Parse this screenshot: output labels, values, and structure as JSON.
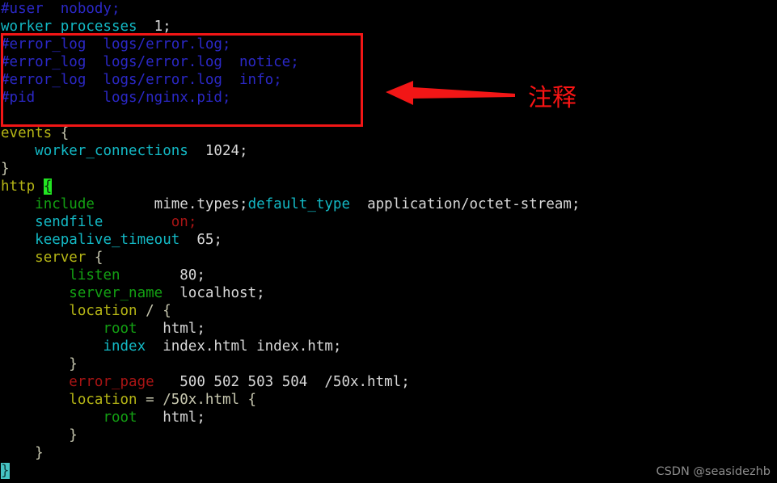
{
  "window": {
    "app": "vim",
    "file": "nginx.conf",
    "background": "#000000"
  },
  "colors": {
    "comment": "#2b28c6",
    "directive": "#13b8c4",
    "value": "#d8d8d8",
    "block": "#b5b515",
    "green": "#13a013",
    "red": "#a81414",
    "cursor_green": "#22e522",
    "cursor_cyan": "#46c3c3",
    "annotation": "#f21616"
  },
  "code": {
    "lines": [
      {
        "id": 1,
        "spans": [
          {
            "t": "#user  nobody;",
            "c": "comment"
          }
        ]
      },
      {
        "id": 2,
        "spans": [
          {
            "t": "worker_processes",
            "c": "directive"
          },
          {
            "t": "  1;",
            "c": "value"
          }
        ]
      },
      {
        "id": 3,
        "spans": [
          {
            "t": "#error_log  logs/error.log;",
            "c": "comment"
          }
        ]
      },
      {
        "id": 4,
        "spans": [
          {
            "t": "#error_log  logs/error.log  notice;",
            "c": "comment"
          }
        ]
      },
      {
        "id": 5,
        "spans": [
          {
            "t": "#error_log  logs/error.log  info;",
            "c": "comment"
          }
        ]
      },
      {
        "id": 6,
        "spans": [
          {
            "t": "#pid        logs/nginx.pid;",
            "c": "comment"
          }
        ]
      },
      {
        "id": 7,
        "spans": [
          {
            "t": "",
            "c": "plain"
          }
        ]
      },
      {
        "id": 8,
        "spans": [
          {
            "t": "events",
            "c": "block"
          },
          {
            "t": " {",
            "c": "brace"
          }
        ]
      },
      {
        "id": 9,
        "spans": [
          {
            "t": "    ",
            "c": "plain"
          },
          {
            "t": "worker_connections",
            "c": "directive"
          },
          {
            "t": "  1024;",
            "c": "value"
          }
        ]
      },
      {
        "id": 10,
        "spans": [
          {
            "t": "}",
            "c": "brace"
          }
        ]
      },
      {
        "id": 11,
        "spans": [
          {
            "t": "http",
            "c": "block"
          },
          {
            "t": " ",
            "c": "plain"
          },
          {
            "t": "{",
            "c": "cursor-green"
          }
        ]
      },
      {
        "id": 12,
        "spans": [
          {
            "t": "    ",
            "c": "plain"
          },
          {
            "t": "include",
            "c": "green"
          },
          {
            "t": "       mime.types;",
            "c": "value"
          },
          {
            "t": "default_type",
            "c": "directive"
          },
          {
            "t": "  application/octet-stream;",
            "c": "value"
          }
        ]
      },
      {
        "id": 13,
        "spans": [
          {
            "t": "    ",
            "c": "plain"
          },
          {
            "t": "sendfile",
            "c": "directive"
          },
          {
            "t": "        ",
            "c": "plain"
          },
          {
            "t": "on;",
            "c": "red"
          }
        ]
      },
      {
        "id": 14,
        "spans": [
          {
            "t": "    ",
            "c": "plain"
          },
          {
            "t": "keepalive_timeout",
            "c": "directive"
          },
          {
            "t": "  65;",
            "c": "value"
          }
        ]
      },
      {
        "id": 15,
        "spans": [
          {
            "t": "    ",
            "c": "plain"
          },
          {
            "t": "server",
            "c": "block"
          },
          {
            "t": " {",
            "c": "brace"
          }
        ]
      },
      {
        "id": 16,
        "spans": [
          {
            "t": "        ",
            "c": "plain"
          },
          {
            "t": "listen",
            "c": "green"
          },
          {
            "t": "       80;",
            "c": "value"
          }
        ]
      },
      {
        "id": 17,
        "spans": [
          {
            "t": "        ",
            "c": "plain"
          },
          {
            "t": "server_name",
            "c": "green"
          },
          {
            "t": "  localhost;",
            "c": "value"
          }
        ]
      },
      {
        "id": 18,
        "spans": [
          {
            "t": "        ",
            "c": "plain"
          },
          {
            "t": "location",
            "c": "block"
          },
          {
            "t": " / {",
            "c": "brace"
          }
        ]
      },
      {
        "id": 19,
        "spans": [
          {
            "t": "            ",
            "c": "plain"
          },
          {
            "t": "root",
            "c": "green"
          },
          {
            "t": "   html;",
            "c": "value"
          }
        ]
      },
      {
        "id": 20,
        "spans": [
          {
            "t": "            ",
            "c": "plain"
          },
          {
            "t": "index",
            "c": "directive"
          },
          {
            "t": "  index.html index.htm;",
            "c": "value"
          }
        ]
      },
      {
        "id": 21,
        "spans": [
          {
            "t": "        }",
            "c": "brace"
          }
        ]
      },
      {
        "id": 22,
        "spans": [
          {
            "t": "        ",
            "c": "plain"
          },
          {
            "t": "error_page",
            "c": "red"
          },
          {
            "t": "   500 502 503 504  /50x.html;",
            "c": "value"
          }
        ]
      },
      {
        "id": 23,
        "spans": [
          {
            "t": "        ",
            "c": "plain"
          },
          {
            "t": "location",
            "c": "block"
          },
          {
            "t": " = /50x.html {",
            "c": "brace"
          }
        ]
      },
      {
        "id": 24,
        "spans": [
          {
            "t": "            ",
            "c": "plain"
          },
          {
            "t": "root",
            "c": "green"
          },
          {
            "t": "   html;",
            "c": "value"
          }
        ]
      },
      {
        "id": 25,
        "spans": [
          {
            "t": "        }",
            "c": "brace"
          }
        ]
      },
      {
        "id": 26,
        "spans": [
          {
            "t": "    }",
            "c": "brace"
          }
        ]
      },
      {
        "id": 27,
        "spans": [
          {
            "t": "}",
            "c": "cursor-cyan"
          }
        ]
      }
    ]
  },
  "annotation": {
    "label": "注释",
    "arrow_direction": "left",
    "box_target_lines": "3-6"
  },
  "watermark": {
    "text": "CSDN @seasidezhb"
  }
}
